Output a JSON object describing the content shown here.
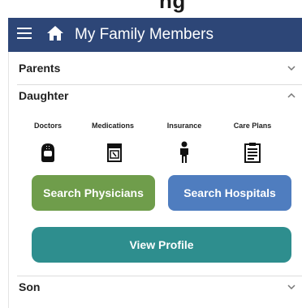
{
  "header": {
    "top_fragment": "ng",
    "title": "My Family Members",
    "menu_icon": "hamburger-menu-icon",
    "home_icon": "home-icon"
  },
  "sections": [
    {
      "label": "Parents",
      "state": "collapsed"
    },
    {
      "label": "Daughter",
      "state": "expanded"
    },
    {
      "label": "Son",
      "state": "collapsed"
    }
  ],
  "daughter": {
    "categories": [
      {
        "label": "Doctors",
        "icon": "doctor-icon"
      },
      {
        "label": "Medications",
        "icon": "medications-icon"
      },
      {
        "label": "Insurance",
        "icon": "person-icon"
      },
      {
        "label": "Care Plans",
        "icon": "clipboard-icon"
      }
    ],
    "buttons": {
      "search_physicians": "Search Physicians",
      "search_hospitals": "Search Hospitals",
      "view_profile": "View Profile"
    }
  },
  "colors": {
    "appbar": "#2d4677",
    "green_button": "#6f9d4b",
    "blue_button": "#4f7dbf",
    "teal_button": "#2e8e8e"
  }
}
